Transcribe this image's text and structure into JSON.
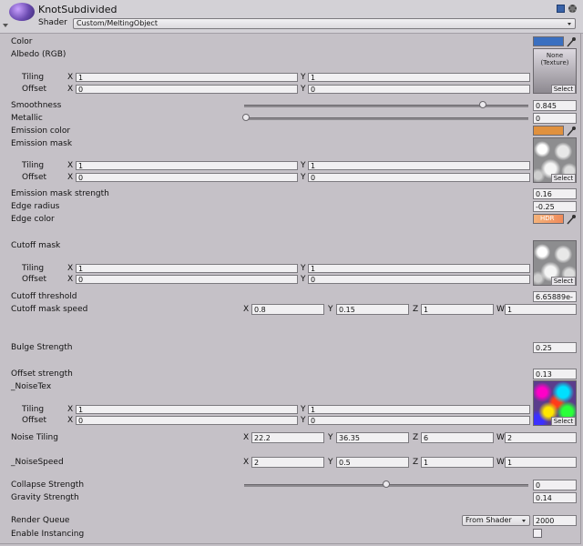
{
  "header": {
    "title": "KnotSubdivided",
    "shader_label": "Shader",
    "shader_value": "Custom/MeltingObject"
  },
  "props": {
    "color": "Color",
    "albedo": "Albedo (RGB)",
    "albedo_texture": "None\n(Texture)",
    "smoothness": "Smoothness",
    "smoothness_value": "0.845",
    "smoothness_level": 0.845,
    "metallic": "Metallic",
    "metallic_value": "0",
    "metallic_level": 0,
    "emission_color": "Emission color",
    "emission_mask": "Emission mask",
    "emission_mask_strength": "Emission mask strength",
    "emission_mask_strength_value": "0.16",
    "edge_radius": "Edge radius",
    "edge_radius_value": "-0.25",
    "edge_color": "Edge color",
    "hdr": "HDR",
    "cutoff_mask": "Cutoff mask",
    "cutoff_threshold": "Cutoff threshold",
    "cutoff_threshold_value": "6.65889e-",
    "cutoff_mask_speed": "Cutoff mask speed",
    "bulge_strength": "Bulge Strength",
    "bulge_strength_value": "0.25",
    "offset_strength": "Offset strength",
    "offset_strength_value": "0.13",
    "noise_tex": "_NoiseTex",
    "noise_tiling": "Noise Tiling",
    "noise_speed": "_NoiseSpeed",
    "collapse_strength": "Collapse Strength",
    "collapse_strength_value": "0",
    "collapse_level": 0.5,
    "gravity_strength": "Gravity Strength",
    "gravity_strength_value": "0.14",
    "render_queue": "Render Queue",
    "render_queue_mode": "From Shader",
    "render_queue_value": "2000",
    "enable_instancing": "Enable Instancing"
  },
  "common": {
    "tiling": "Tiling",
    "offset": "Offset",
    "x": "X",
    "y": "Y",
    "z": "Z",
    "w": "W",
    "select": "Select"
  },
  "albedo_st": {
    "tx": "1",
    "ty": "1",
    "ox": "0",
    "oy": "0"
  },
  "emission_st": {
    "tx": "1",
    "ty": "1",
    "ox": "0",
    "oy": "0"
  },
  "cutoff_st": {
    "tx": "1",
    "ty": "1",
    "ox": "0",
    "oy": "0"
  },
  "noise_st": {
    "tx": "1",
    "ty": "1",
    "ox": "0",
    "oy": "0"
  },
  "cutoff_speed": {
    "x": "0.8",
    "y": "0.15",
    "z": "1",
    "w": "1"
  },
  "noise_tiling": {
    "x": "22.2",
    "y": "36.35",
    "z": "6",
    "w": "2"
  },
  "noise_speed": {
    "x": "2",
    "y": "0.5",
    "z": "1",
    "w": "1"
  },
  "colors": {
    "color_swatch": "#3a6fc0",
    "emission_swatch": "#e0913e",
    "edge_swatch": "#f0a070"
  },
  "icons": [
    "material-sphere-icon",
    "book-help-icon",
    "settings-gear-icon",
    "eyedropper-icon",
    "dropdown-arrow-icon",
    "foldout-arrow-icon"
  ]
}
